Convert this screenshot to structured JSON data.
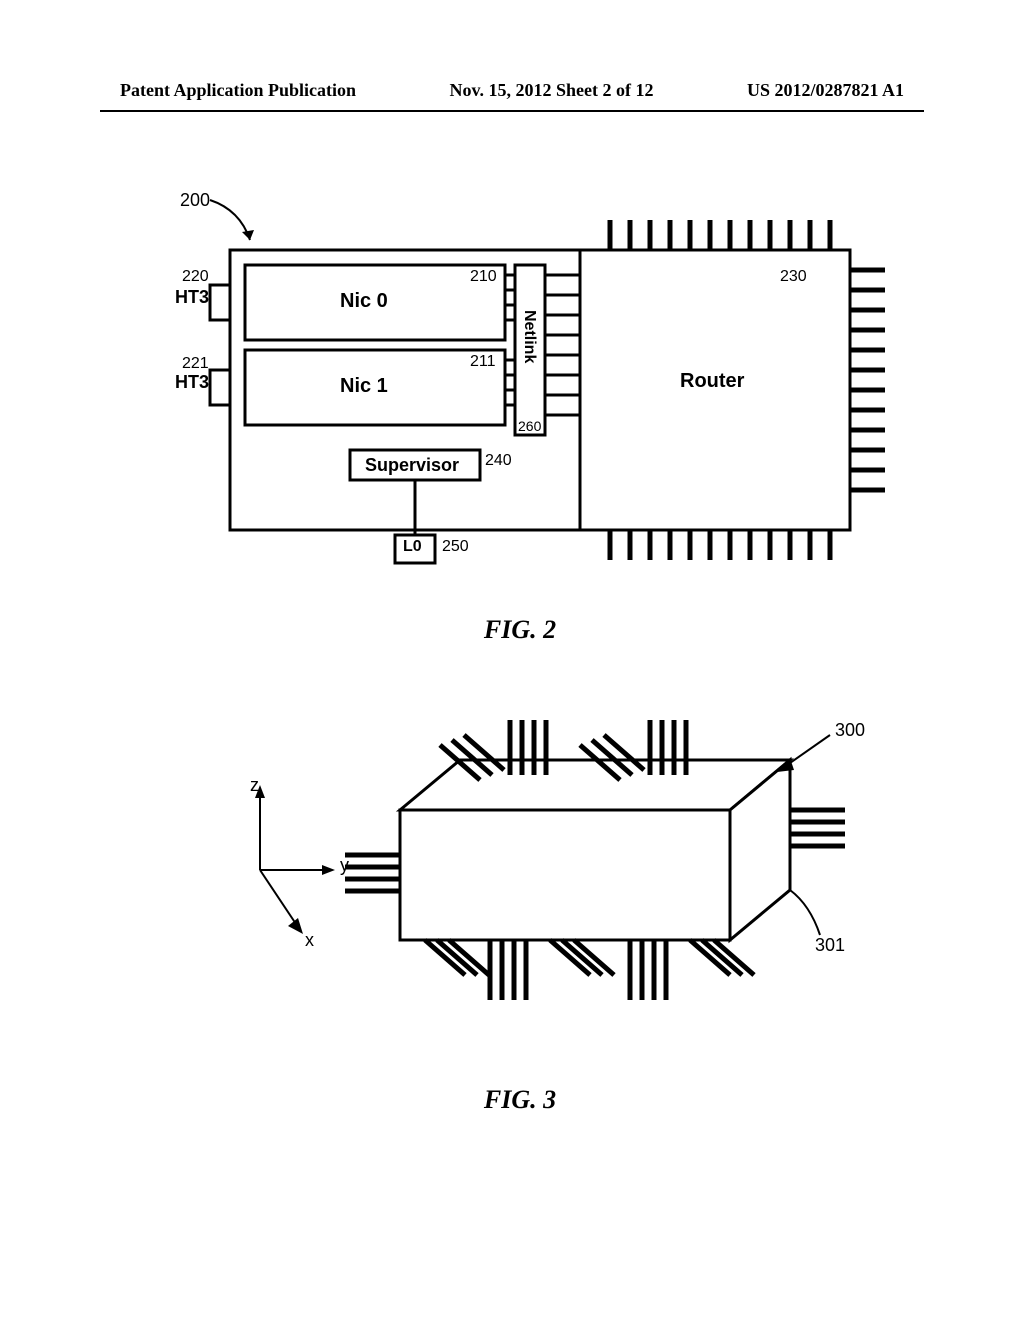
{
  "header": {
    "left": "Patent Application Publication",
    "center": "Nov. 15, 2012  Sheet 2 of 12",
    "right": "US 2012/0287821 A1"
  },
  "fig2": {
    "caption": "FIG. 2",
    "ref_200": "200",
    "ref_210": "210",
    "ref_211": "211",
    "ref_220": "220",
    "ref_221": "221",
    "ref_230": "230",
    "ref_240": "240",
    "ref_250": "250",
    "ref_260": "260",
    "nic0": "Nic 0",
    "nic1": "Nic 1",
    "ht3_top": "HT3",
    "ht3_bottom": "HT3",
    "netlink": "Netlink",
    "router": "Router",
    "supervisor": "Supervisor",
    "lo": "L0"
  },
  "fig3": {
    "caption": "FIG. 3",
    "ref_300": "300",
    "ref_301": "301",
    "axis_x": "x",
    "axis_y": "y",
    "axis_z": "z"
  }
}
